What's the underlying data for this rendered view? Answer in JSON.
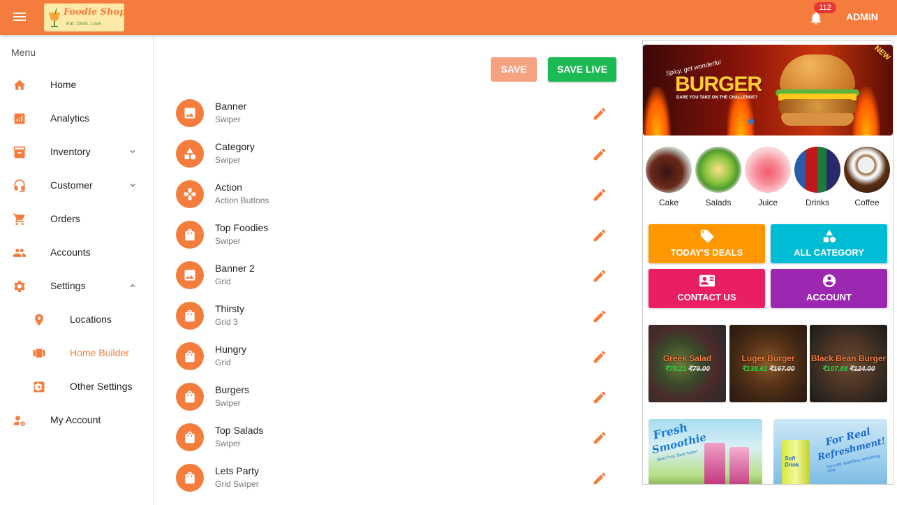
{
  "header": {
    "logo_name": "Foodie Shopie",
    "logo_tagline": "Eat. Drink. Love.",
    "notification_count": "112",
    "user_label": "ADMIN",
    "accent_color": "#f47c3c"
  },
  "sidebar": {
    "heading": "Menu",
    "items": [
      {
        "label": "Home",
        "icon": "home-icon"
      },
      {
        "label": "Analytics",
        "icon": "analytics-icon"
      },
      {
        "label": "Inventory",
        "icon": "inventory-icon",
        "expand": "chevron-down-icon"
      },
      {
        "label": "Customer",
        "icon": "headset-icon",
        "expand": "chevron-down-icon"
      },
      {
        "label": "Orders",
        "icon": "cart-icon"
      },
      {
        "label": "Accounts",
        "icon": "people-icon"
      },
      {
        "label": "Settings",
        "icon": "gear-icon",
        "expand": "chevron-up-icon"
      },
      {
        "label": "Locations",
        "icon": "location-pin-icon"
      },
      {
        "label": "Home Builder",
        "icon": "view-carousel-icon",
        "active": true
      },
      {
        "label": "Other Settings",
        "icon": "settings-box-icon"
      },
      {
        "label": "My Account",
        "icon": "manage-account-icon"
      }
    ]
  },
  "toolbar": {
    "save_label": "SAVE",
    "save_live_label": "SAVE LIVE"
  },
  "sections": [
    {
      "title": "Banner",
      "subtitle": "Swiper",
      "icon": "image-icon"
    },
    {
      "title": "Category",
      "subtitle": "Swiper",
      "icon": "category-shapes-icon"
    },
    {
      "title": "Action",
      "subtitle": "Action Buttons",
      "icon": "gamepad-icon"
    },
    {
      "title": "Top Foodies",
      "subtitle": "Swiper",
      "icon": "shopping-bag-icon"
    },
    {
      "title": "Banner 2",
      "subtitle": "Grid",
      "icon": "image-icon"
    },
    {
      "title": "Thirsty",
      "subtitle": "Grid 3",
      "icon": "shopping-bag-icon"
    },
    {
      "title": "Hungry",
      "subtitle": "Grid",
      "icon": "shopping-bag-icon"
    },
    {
      "title": "Burgers",
      "subtitle": "Swiper",
      "icon": "shopping-bag-icon"
    },
    {
      "title": "Top Salads",
      "subtitle": "Swiper",
      "icon": "shopping-bag-icon"
    },
    {
      "title": "Lets Party",
      "subtitle": "Grid Swiper",
      "icon": "shopping-bag-icon"
    }
  ],
  "preview": {
    "banner": {
      "tagline": "Spicy, get wonderful",
      "headline": "BURGER",
      "subline": "DARE YOU TAKE ON THE CHALLENGE?",
      "corner_tag": "NEW"
    },
    "categories": [
      "Cake",
      "Salads",
      "Juice",
      "Drinks",
      "Coffee"
    ],
    "actions": [
      {
        "label": "TODAY'S DEALS",
        "color": "#ff9800",
        "icon": "tag-icon"
      },
      {
        "label": "ALL CATEGORY",
        "color": "#00bcd4",
        "icon": "category-shapes-icon"
      },
      {
        "label": "CONTACT US",
        "color": "#e91e63",
        "icon": "contact-card-icon"
      },
      {
        "label": "ACCOUNT",
        "color": "#9c27b0",
        "icon": "account-circle-icon"
      }
    ],
    "foodies": [
      {
        "name": "Greek Salad",
        "price": "₹78.21",
        "was": "₹79.00"
      },
      {
        "name": "Luger Burger",
        "price": "₹138.61",
        "was": "₹167.00"
      },
      {
        "name": "Black Bean Burger",
        "price": "₹107.88",
        "was": "₹124.00"
      }
    ],
    "promos": [
      {
        "line1": "Fresh",
        "line2": "Smoothie",
        "small": "Best Fruit, Best Taste!"
      },
      {
        "line1": "For Real",
        "line2": "Refreshment!",
        "small": "Ice-cold, sparkling, refreshing cola",
        "can": "Soft Drink"
      }
    ]
  }
}
